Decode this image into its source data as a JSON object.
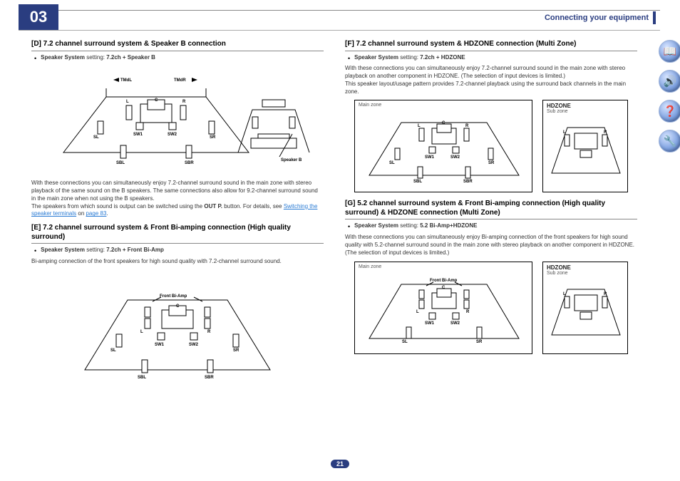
{
  "chapter_number": "03",
  "header_title": "Connecting your equipment",
  "page_number": "21",
  "left": {
    "D": {
      "heading": "[D] 7.2 channel surround system & Speaker B connection",
      "setting_label": "Speaker System",
      "setting_text": " setting: ",
      "setting_value": "7.2ch + Speaker B",
      "para1": "With these connections you can simultaneously enjoy 7.2-channel surround sound in the main zone with stereo playback of the same sound on the B speakers. The same connections also allow for 9.2-channel surround sound in the main zone when not using the B speakers.",
      "para2a": "The speakers from which sound is output can be switched using the ",
      "para2b": "OUT P.",
      "para2c": " button. For details, see ",
      "link_text": "Switching the speaker terminals",
      "para2d": " on ",
      "link_page": "page 83",
      "period": ".",
      "labels": {
        "TMdL": "TMdL",
        "TMdR": "TMdR",
        "L": "L",
        "C": "C",
        "R": "R",
        "SL": "SL",
        "SR": "SR",
        "SW1": "SW1",
        "SW2": "SW2",
        "SBL": "SBL",
        "SBR": "SBR",
        "SpeakerB": "Speaker B"
      }
    },
    "E": {
      "heading": "[E] 7.2 channel surround system & Front Bi-amping connection (High quality surround)",
      "setting_label": "Speaker System",
      "setting_text": " setting: ",
      "setting_value": "7.2ch + Front Bi-Amp",
      "para": "Bi-amping connection of the front speakers for high sound quality with 7.2-channel surround sound.",
      "labels": {
        "FrontBiAmp": "Front Bi-Amp",
        "L": "L",
        "C": "C",
        "R": "R",
        "SL": "SL",
        "SR": "SR",
        "SW1": "SW1",
        "SW2": "SW2",
        "SBL": "SBL",
        "SBR": "SBR"
      }
    }
  },
  "right": {
    "F": {
      "heading": "[F] 7.2 channel surround system & HDZONE connection (Multi Zone)",
      "setting_label": "Speaker System",
      "setting_text": " setting: ",
      "setting_value": "7.2ch + HDZONE",
      "para1": "With these connections you can simultaneously enjoy 7.2-channel surround sound in the main zone with stereo playback on another component in HDZONE. (The selection of input devices is limited.)",
      "para2": "This speaker layout/usage pattern provides 7.2-channel playback using the surround back channels in the main zone.",
      "main_zone_label": "Main zone",
      "hdzone_label": "HDZONE",
      "sub_zone_label": "Sub zone",
      "labels": {
        "L": "L",
        "C": "C",
        "R": "R",
        "SL": "SL",
        "SR": "SR",
        "SW1": "SW1",
        "SW2": "SW2",
        "SBL": "SBL",
        "SBR": "SBR"
      }
    },
    "G": {
      "heading": "[G] 5.2 channel surround system & Front Bi-amping connection (High quality surround) & HDZONE connection (Multi Zone)",
      "setting_label": "Speaker System",
      "setting_text": " setting: ",
      "setting_value": "5.2 Bi-Amp+HDZONE",
      "para": "With these connections you can simultaneously enjoy Bi-amping connection of the front speakers for high sound quality with 5.2-channel surround sound in the main zone with stereo playback on another component in HDZONE. (The selection of input devices is limited.)",
      "main_zone_label": "Main zone",
      "hdzone_label": "HDZONE",
      "sub_zone_label": "Sub zone",
      "labels": {
        "FrontBiAmp": "Front Bi-Amp",
        "L": "L",
        "C": "C",
        "R": "R",
        "SL": "SL",
        "SR": "SR",
        "SW1": "SW1",
        "SW2": "SW2"
      }
    }
  },
  "icons": {
    "book": "book-icon",
    "speaker": "speaker-icon",
    "help": "help-icon",
    "gear": "gear-icon"
  }
}
